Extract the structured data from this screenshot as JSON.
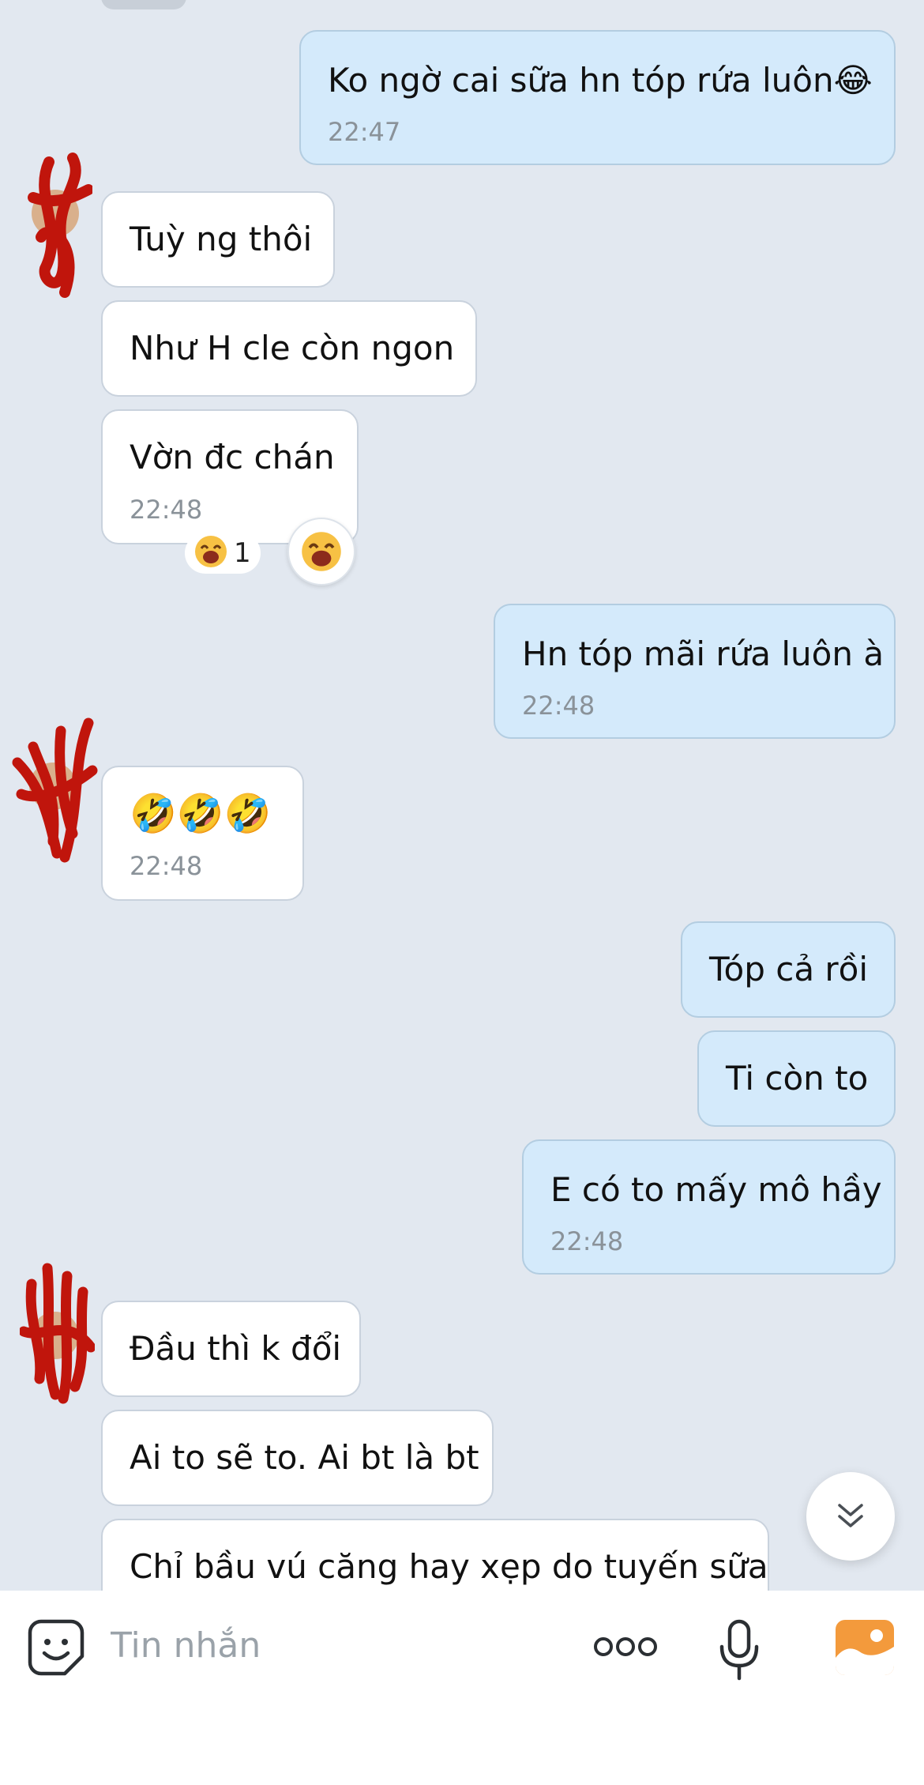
{
  "conversation": [
    {
      "side": "sent",
      "text": "Ko ngờ cai sữa hn tóp rứa luôn😂",
      "time": "22:47"
    },
    {
      "side": "recv",
      "text": "Tuỳ ng thôi"
    },
    {
      "side": "recv",
      "text": "Như H cle còn ngon"
    },
    {
      "side": "recv",
      "text": "Vờn đc chán",
      "time": "22:48",
      "reaction": {
        "emoji": "😮",
        "count": "1"
      }
    },
    {
      "side": "sent",
      "text": "Hn tóp mãi rứa luôn à",
      "time": "22:48"
    },
    {
      "side": "recv",
      "text": "🤣🤣🤣",
      "time": "22:48"
    },
    {
      "side": "sent",
      "text": "Tóp cả rồi"
    },
    {
      "side": "sent",
      "text": "Ti còn to"
    },
    {
      "side": "sent",
      "text": "E có to mấy mô hầy",
      "time": "22:48"
    },
    {
      "side": "recv",
      "text": "Đầu thì k đổi"
    },
    {
      "side": "recv",
      "text": "Ai to sẽ to. Ai bt là bt"
    },
    {
      "side": "recv",
      "text": "Chỉ bầu vú căng hay xẹp do tuyến sữa"
    }
  ],
  "input": {
    "placeholder": "Tin nhắn"
  },
  "icons": {
    "sticker": "sticker-smiley-icon",
    "more": "more-dots-icon",
    "mic": "microphone-icon",
    "image": "image-gallery-icon",
    "scroll": "double-chevron-down-icon",
    "avatar": "redacted-avatar"
  },
  "colors": {
    "background": "#e2e8f0",
    "sent_bubble": "#d4eafb",
    "received_bubble": "#ffffff",
    "redaction": "#c0150c",
    "image_icon": "#f39a3c"
  }
}
